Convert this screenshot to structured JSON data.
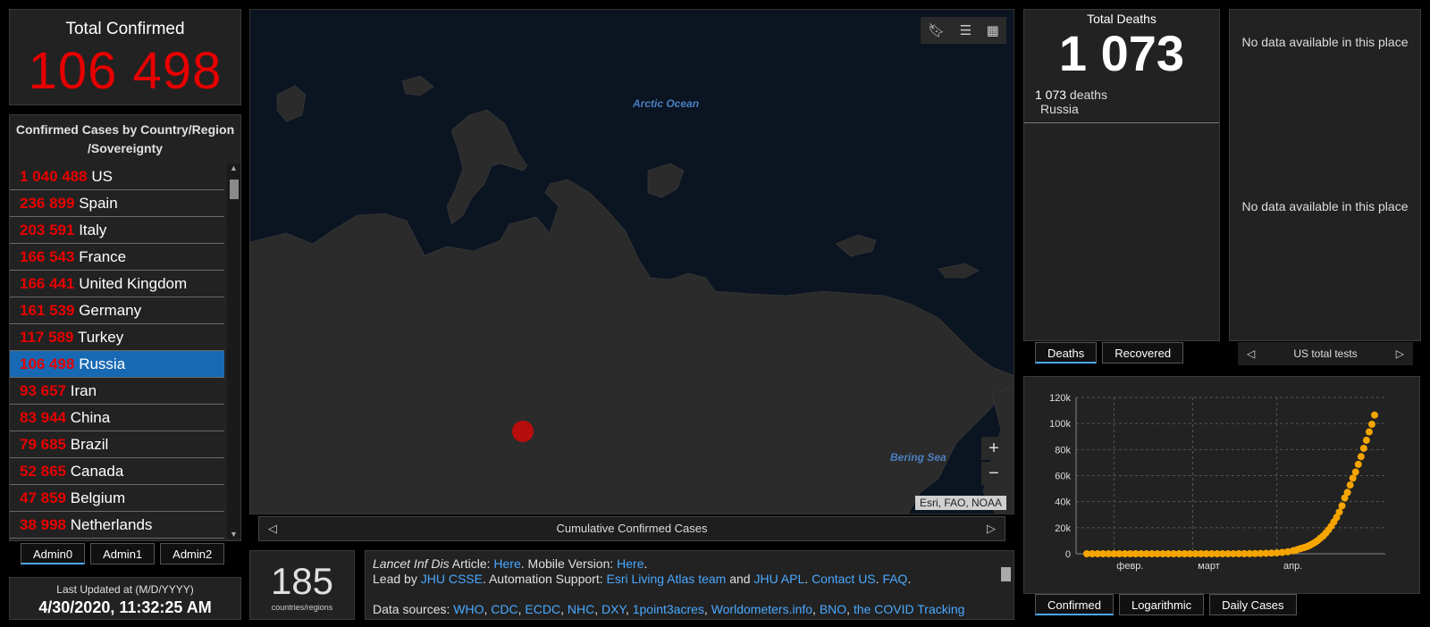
{
  "total_confirmed": {
    "label": "Total Confirmed",
    "value": "106 498"
  },
  "country_list": {
    "header": "Confirmed Cases by Country/Region /Sovereignty",
    "rows": [
      {
        "count": "1 040 488",
        "name": "US"
      },
      {
        "count": "236 899",
        "name": "Spain"
      },
      {
        "count": "203 591",
        "name": "Italy"
      },
      {
        "count": "166 543",
        "name": "France"
      },
      {
        "count": "166 441",
        "name": "United Kingdom"
      },
      {
        "count": "161 539",
        "name": "Germany"
      },
      {
        "count": "117 589",
        "name": "Turkey"
      },
      {
        "count": "106 498",
        "name": "Russia"
      },
      {
        "count": "93 657",
        "name": "Iran"
      },
      {
        "count": "83 944",
        "name": "China"
      },
      {
        "count": "79 685",
        "name": "Brazil"
      },
      {
        "count": "52 865",
        "name": "Canada"
      },
      {
        "count": "47 859",
        "name": "Belgium"
      },
      {
        "count": "38 998",
        "name": "Netherlands"
      }
    ],
    "selected_index": 7
  },
  "admin_tabs": [
    "Admin0",
    "Admin1",
    "Admin2"
  ],
  "last_updated": {
    "label": "Last Updated at (M/D/YYYY)",
    "value": "4/30/2020, 11:32:25 AM"
  },
  "map": {
    "labels": [
      "Arctic Ocean",
      "Bering Sea"
    ],
    "attribution": "Esri, FAO, NOAA",
    "caption": "Cumulative Confirmed Cases",
    "toolbar_icons": [
      "bookmark-icon",
      "list-icon",
      "qr-grid-icon"
    ],
    "zoom_in": "+",
    "zoom_out": "−",
    "land_color": "#2b2b2b",
    "water_color": "#0b1421",
    "marker_color": "#b80d0d"
  },
  "country_count": {
    "value": "185",
    "label": "countries/regions"
  },
  "info": {
    "line1_prefix_em": "Lancet Inf Dis",
    "line1_a": " Article: ",
    "line1_link1": "Here",
    "line1_b": ". Mobile Version: ",
    "line1_link2": "Here",
    "line1_c": ".",
    "line2_a": "Lead by ",
    "line2_link1": "JHU CSSE",
    "line2_b": ". Automation Support: ",
    "line2_link2": "Esri Living Atlas team",
    "line2_c": " and ",
    "line2_link3": "JHU APL",
    "line2_d": ". ",
    "line2_link4": "Contact US",
    "line2_e": ". ",
    "line2_link5": "FAQ",
    "line2_f": ".",
    "line3_a": "Data sources: ",
    "line3_links": [
      "WHO",
      "CDC",
      "ECDC",
      "NHC",
      "DXY",
      "1point3acres",
      "Worldometers.info",
      "BNO",
      "the COVID Tracking"
    ]
  },
  "deaths": {
    "label": "Total Deaths",
    "value": "1 073",
    "detail_count": "1 073",
    "detail_word": " deaths",
    "detail_place": "Russia"
  },
  "deaths_tabs": [
    "Deaths",
    "Recovered"
  ],
  "tests": {
    "no_data_1": "No data available in this place",
    "no_data_2": "No data available in this place",
    "nav_label": "US total tests"
  },
  "chart_tabs": [
    "Confirmed",
    "Logarithmic",
    "Daily Cases"
  ],
  "chart_data": {
    "type": "scatter",
    "x_tick_labels": [
      "февр.",
      "март",
      "апр."
    ],
    "y_tick_labels": [
      "0",
      "20k",
      "40k",
      "60k",
      "80k",
      "100k",
      "120k"
    ],
    "ylim": [
      0,
      120000
    ],
    "color": "#f5a500",
    "grid": true,
    "x_domain_days": [
      0,
      100
    ],
    "points": [
      [
        0,
        0
      ],
      [
        2,
        0
      ],
      [
        4,
        0
      ],
      [
        6,
        0
      ],
      [
        8,
        0
      ],
      [
        10,
        0
      ],
      [
        12,
        0
      ],
      [
        14,
        0
      ],
      [
        16,
        0
      ],
      [
        18,
        0
      ],
      [
        20,
        0
      ],
      [
        22,
        0
      ],
      [
        24,
        0
      ],
      [
        26,
        0
      ],
      [
        28,
        0
      ],
      [
        30,
        2
      ],
      [
        32,
        2
      ],
      [
        34,
        2
      ],
      [
        36,
        2
      ],
      [
        38,
        2
      ],
      [
        40,
        2
      ],
      [
        42,
        2
      ],
      [
        44,
        2
      ],
      [
        46,
        2
      ],
      [
        48,
        5
      ],
      [
        50,
        10
      ],
      [
        52,
        17
      ],
      [
        54,
        28
      ],
      [
        56,
        45
      ],
      [
        58,
        63
      ],
      [
        60,
        90
      ],
      [
        62,
        147
      ],
      [
        64,
        253
      ],
      [
        66,
        367
      ],
      [
        68,
        495
      ],
      [
        70,
        658
      ],
      [
        72,
        1036
      ],
      [
        74,
        1534
      ],
      [
        76,
        2337
      ],
      [
        77,
        2777
      ],
      [
        78,
        3548
      ],
      [
        79,
        4149
      ],
      [
        80,
        4731
      ],
      [
        81,
        5389
      ],
      [
        82,
        6343
      ],
      [
        83,
        7497
      ],
      [
        84,
        8672
      ],
      [
        85,
        10131
      ],
      [
        86,
        11917
      ],
      [
        87,
        13584
      ],
      [
        88,
        15770
      ],
      [
        89,
        18328
      ],
      [
        90,
        21102
      ],
      [
        91,
        24490
      ],
      [
        92,
        27938
      ],
      [
        93,
        32008
      ],
      [
        94,
        36793
      ],
      [
        95,
        42853
      ],
      [
        96,
        47121
      ],
      [
        97,
        52763
      ],
      [
        98,
        57999
      ],
      [
        99,
        62773
      ],
      [
        100,
        68622
      ],
      [
        101,
        74588
      ],
      [
        102,
        80949
      ],
      [
        103,
        87147
      ],
      [
        104,
        93558
      ],
      [
        105,
        99399
      ],
      [
        106,
        106498
      ]
    ]
  }
}
